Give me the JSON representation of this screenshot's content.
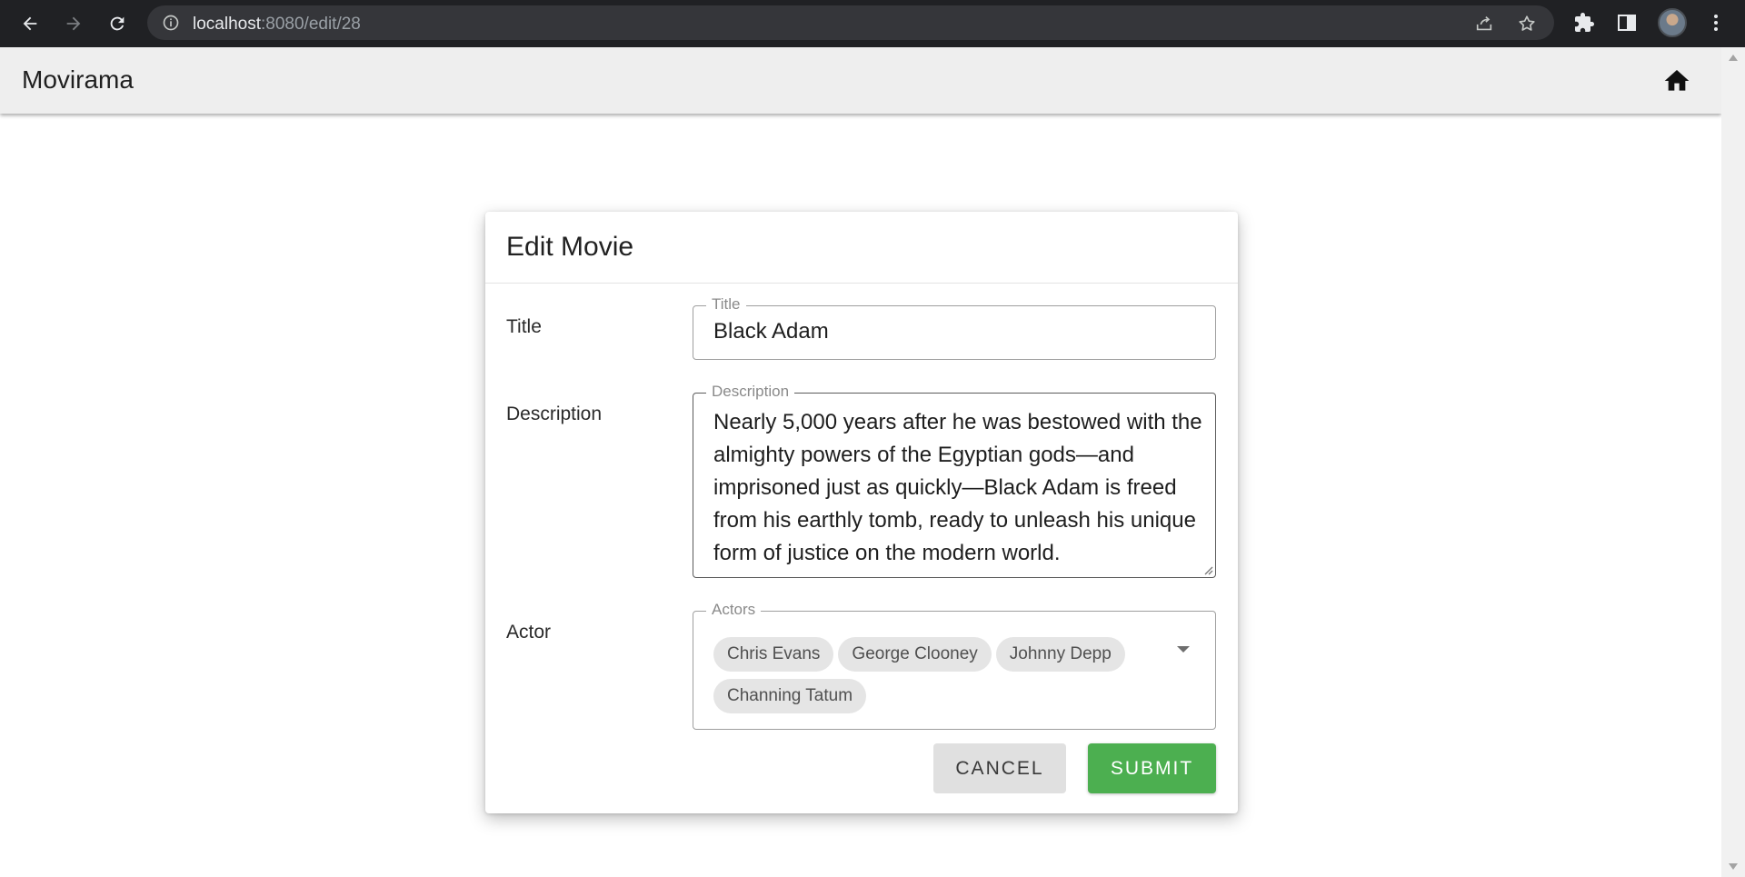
{
  "browser": {
    "url_host": "localhost",
    "url_path": ":8080/edit/28",
    "icons": [
      "back-arrow-icon",
      "forward-arrow-icon",
      "reload-icon",
      "info-icon",
      "share-icon",
      "star-icon",
      "extensions-icon",
      "side-panel-icon",
      "profile-avatar",
      "more-menu-icon"
    ]
  },
  "app": {
    "title": "Movirama",
    "home_icon": "home-icon"
  },
  "dialog": {
    "title": "Edit Movie",
    "title_row": {
      "label": "Title",
      "legend": "Title",
      "value": "Black Adam"
    },
    "description_row": {
      "label": "Description",
      "legend": "Description",
      "value": "Nearly 5,000 years after he was bestowed with the almighty powers of the Egyptian gods—and imprisoned just as quickly—Black Adam is freed from his earthly tomb, ready to unleash his unique form of justice on the modern world."
    },
    "actor_row": {
      "label": "Actor",
      "legend": "Actors",
      "chips": [
        "Chris Evans",
        "George Clooney",
        "Johnny Depp",
        "Channing Tatum"
      ]
    },
    "buttons": {
      "cancel": "CANCEL",
      "submit": "SUBMIT"
    }
  },
  "colors": {
    "browser_chrome": "#202124",
    "app_bar": "#eeeeee",
    "submit": "#4caf50",
    "cancel": "#e0e0e0",
    "chip": "#e5e5e5"
  }
}
